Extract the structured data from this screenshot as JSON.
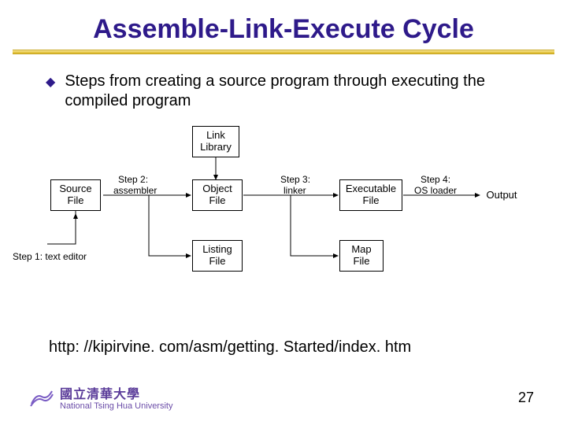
{
  "title": "Assemble-Link-Execute Cycle",
  "bullet": "Steps from creating a source program through executing the compiled program",
  "diagram": {
    "boxes": {
      "source": "Source\nFile",
      "linklib": "Link\nLibrary",
      "object": "Object\nFile",
      "listing": "Listing\nFile",
      "exec": "Executable\nFile",
      "map": "Map\nFile",
      "output": "Output"
    },
    "steps": {
      "s1": "Step 1: text editor",
      "s2a": "Step 2:",
      "s2b": "assembler",
      "s3a": "Step 3:",
      "s3b": "linker",
      "s4a": "Step 4:",
      "s4b": "OS loader"
    }
  },
  "url": "http: //kipirvine. com/asm/getting. Started/index. htm",
  "footer": {
    "uni_cn": "國立清華大學",
    "uni_en": "National Tsing Hua University",
    "page": "27"
  }
}
